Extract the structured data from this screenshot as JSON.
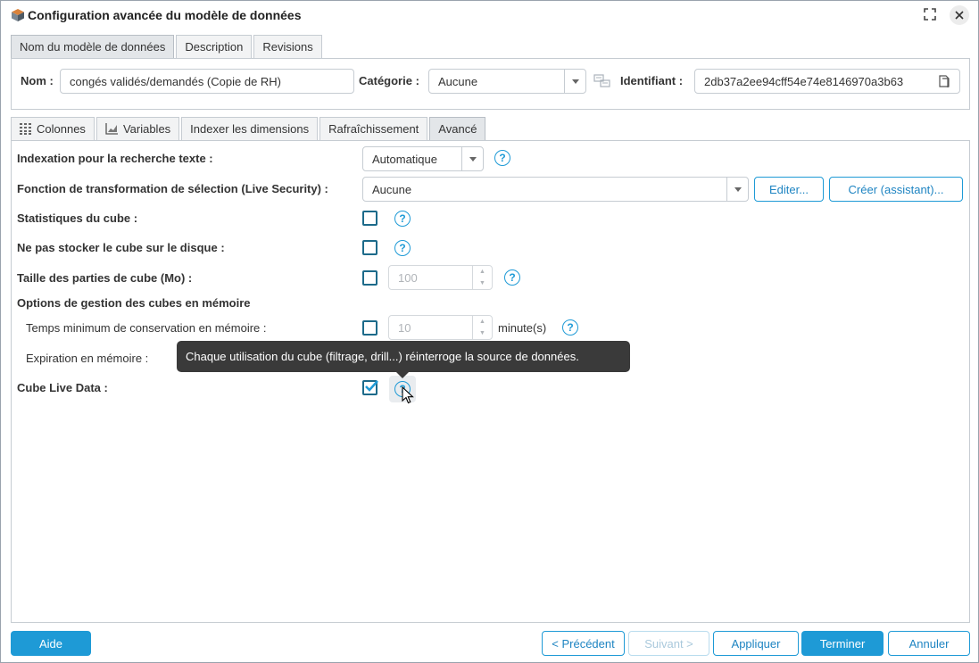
{
  "window": {
    "title": "Configuration avancée du modèle de données",
    "icons": {
      "app": "cube-icon",
      "maximize": "maximize-icon",
      "close": "close-icon"
    }
  },
  "top_tabs": [
    {
      "label": "Nom du modèle de données",
      "active": true
    },
    {
      "label": "Description",
      "active": false
    },
    {
      "label": "Revisions",
      "active": false
    }
  ],
  "name_panel": {
    "name_label": "Nom :",
    "name_value": "congés validés/demandés (Copie de RH)",
    "category_label": "Catégorie :",
    "category_value": "Aucune",
    "identifier_label": "Identifiant :",
    "identifier_value": "2db37a2ee94cff54e74e8146970a3b63"
  },
  "sub_tabs": [
    {
      "label": "Colonnes",
      "icon": "columns-icon",
      "active": false
    },
    {
      "label": "Variables",
      "icon": "chart-icon",
      "active": false
    },
    {
      "label": "Indexer les dimensions",
      "active": false
    },
    {
      "label": "Rafraîchissement",
      "active": false
    },
    {
      "label": "Avancé",
      "active": true
    }
  ],
  "advanced": {
    "text_search_indexing": {
      "label": "Indexation pour la recherche texte :",
      "value": "Automatique"
    },
    "selection_transform": {
      "label": "Fonction de transformation de sélection (Live Security) :",
      "value": "Aucune",
      "edit_button": "Editer...",
      "create_button": "Créer (assistant)..."
    },
    "cube_stats": {
      "label": "Statistiques du cube :",
      "checked": false
    },
    "no_disk_storage": {
      "label": "Ne pas stocker le cube sur le disque :",
      "checked": false
    },
    "cube_part_size": {
      "label": "Taille des parties de cube (Mo) :",
      "checked": false,
      "value": "100"
    },
    "memory_options_header": "Options de gestion des cubes en mémoire",
    "min_retention": {
      "label": "Temps minimum de conservation en mémoire :",
      "checked": false,
      "value": "10",
      "unit": "minute(s)"
    },
    "memory_expiration": {
      "label": "Expiration en mémoire :"
    },
    "live_data": {
      "label": "Cube Live Data :",
      "checked": true
    }
  },
  "tooltip": "Chaque utilisation du cube (filtrage, drill...) réinterroge la source de données.",
  "footer": {
    "help": "Aide",
    "previous": "< Précédent",
    "next": "Suivant >",
    "apply": "Appliquer",
    "finish": "Terminer",
    "cancel": "Annuler"
  },
  "colors": {
    "accent": "#1e9ad6",
    "checkbox": "#1c6a8a",
    "tooltip_bg": "#3a3a3a"
  }
}
